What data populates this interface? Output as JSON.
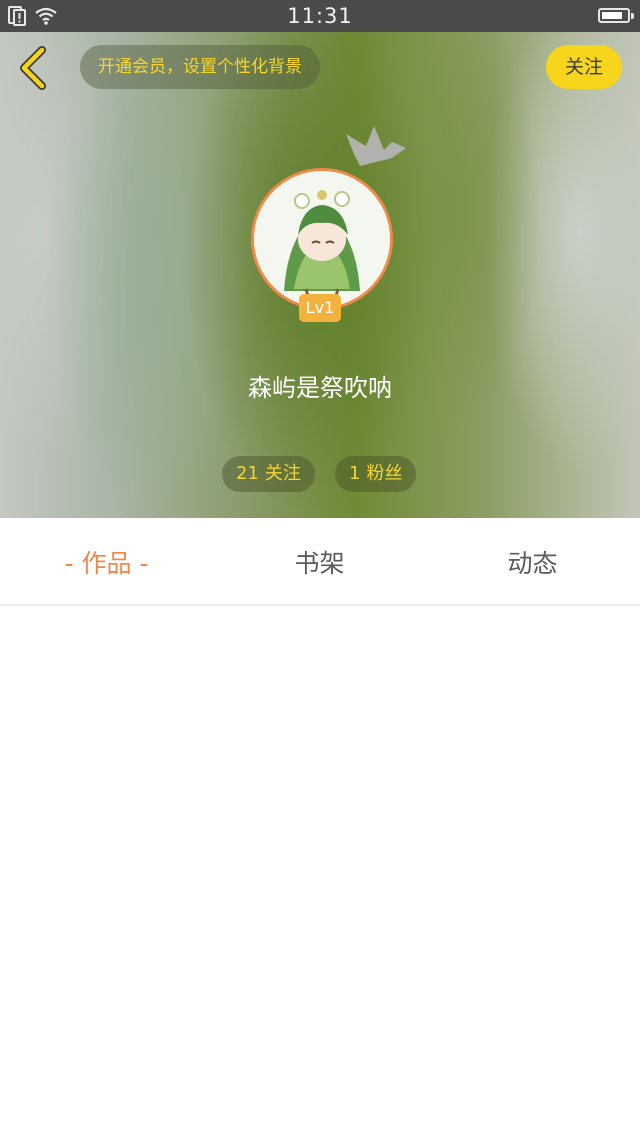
{
  "status_bar": {
    "time": "11:31",
    "battery_level": 0.85,
    "icons": [
      "sim-alert-icon",
      "wifi-icon",
      "battery-icon"
    ]
  },
  "header": {
    "back_icon": "chevron-left-icon",
    "vip_banner": "开通会员，设置个性化背景",
    "follow_label": "关注",
    "level": "Lv1",
    "username": "森屿是祭吹呐",
    "stats": {
      "following_count": "21",
      "following_label": "关注",
      "fans_count": "1",
      "fans_label": "粉丝"
    }
  },
  "tabs": [
    {
      "label": "作品",
      "active": true
    },
    {
      "label": "书架",
      "active": false
    },
    {
      "label": "动态",
      "active": false
    }
  ],
  "colors": {
    "accent_orange": "#f0884a",
    "accent_yellow": "#f7d51d",
    "status_bar": "#4a4a4a",
    "vip_text": "#f6d62e"
  }
}
